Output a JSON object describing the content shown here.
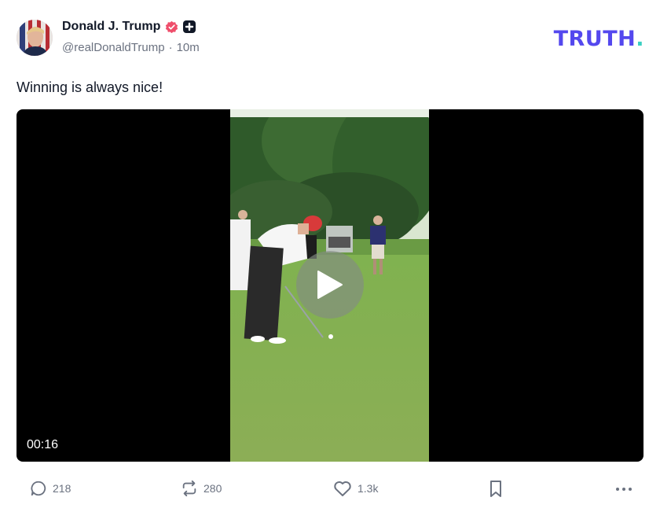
{
  "author": {
    "display_name": "Donald J. Trump",
    "handle": "@realDonaldTrump",
    "separator": "·",
    "time_ago": "10m"
  },
  "brand": {
    "logo_text": "TRUTH",
    "logo_dot": "."
  },
  "post": {
    "text": "Winning is always nice!"
  },
  "media": {
    "duration": "00:16"
  },
  "actions": {
    "replies": "218",
    "retruths": "280",
    "likes": "1.3k"
  },
  "colors": {
    "brand_purple": "#5448ee",
    "brand_teal": "#3bd0c2",
    "verified_badge": "#ef4e6b",
    "text_muted": "#6b7280"
  },
  "icons": {
    "verified": "verified-badge-icon",
    "plus": "plus-icon",
    "reply": "comment-icon",
    "retruth": "repost-icon",
    "like": "heart-icon",
    "bookmark": "bookmark-icon",
    "more": "more-icon",
    "play": "play-icon"
  }
}
